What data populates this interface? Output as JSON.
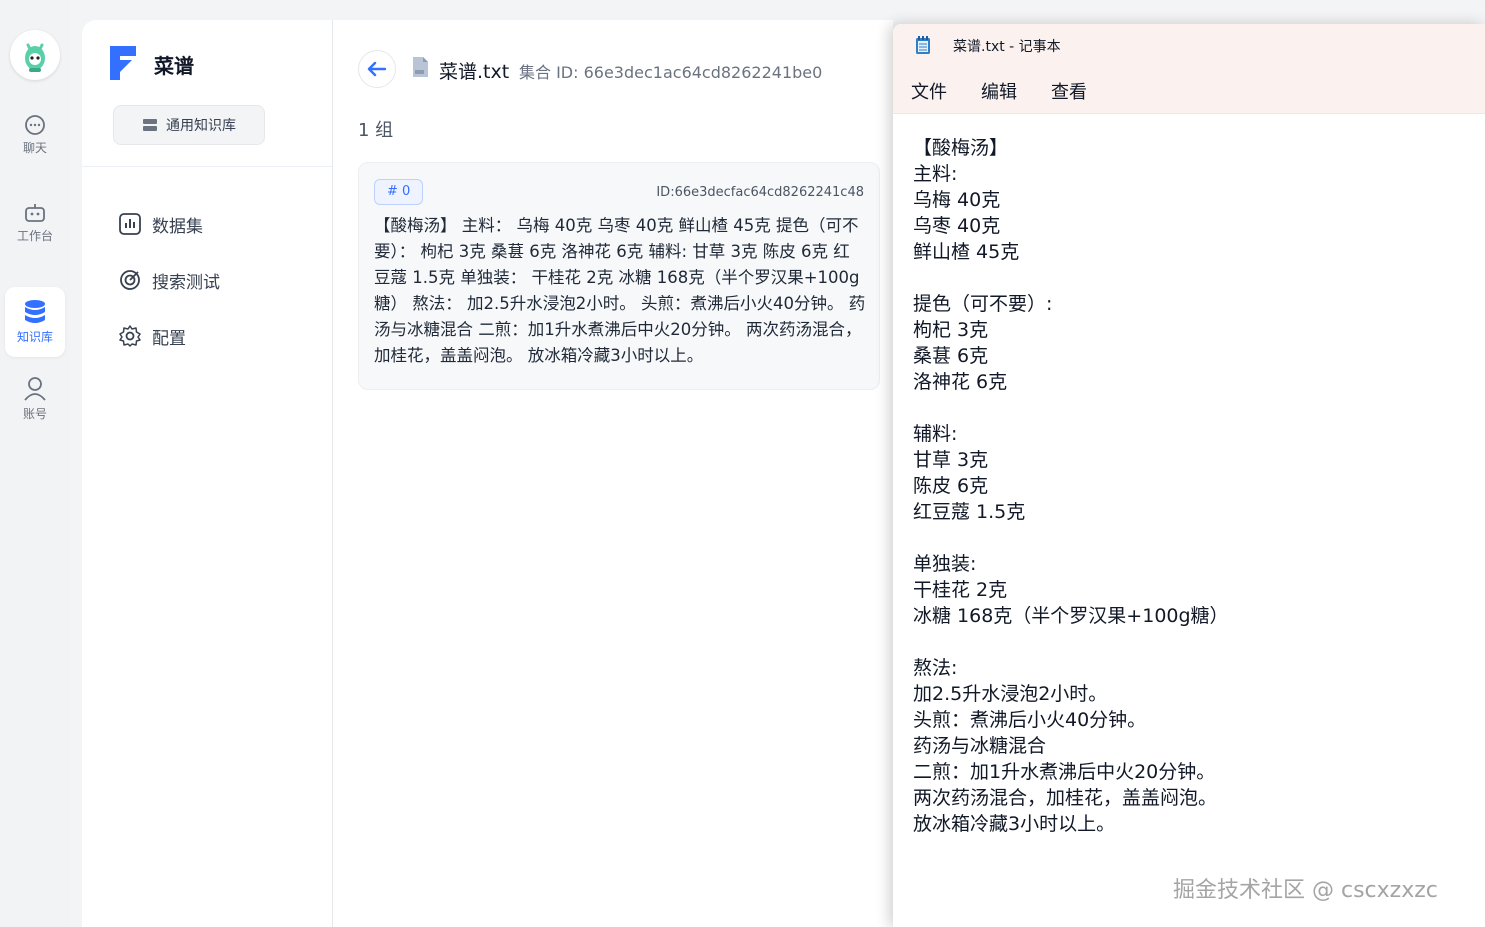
{
  "rail": {
    "items": [
      {
        "label": "聊天",
        "icon": "chat-icon"
      },
      {
        "label": "工作台",
        "icon": "robot-icon"
      },
      {
        "label": "知识库",
        "icon": "database-icon",
        "active": true
      },
      {
        "label": "账号",
        "icon": "user-icon"
      }
    ]
  },
  "sidebar": {
    "title": "菜谱",
    "kb_type": "通用知识库",
    "nav": [
      {
        "label": "数据集",
        "icon": "chart-icon"
      },
      {
        "label": "搜索测试",
        "icon": "target-icon"
      },
      {
        "label": "配置",
        "icon": "gear-icon"
      }
    ]
  },
  "main": {
    "file_name": "菜谱.txt",
    "collection_id": "集合 ID: 66e3dec1ac64cd8262241be0",
    "group_count": "1 组",
    "card": {
      "index": "# 0",
      "id": "ID:66e3decfac64cd8262241c48",
      "text": "【酸梅汤】 主料： 乌梅 40克 乌枣 40克 鲜山楂 45克 提色（可不要）： 枸杞 3克 桑葚 6克 洛神花 6克 辅料: 甘草 3克 陈皮 6克 红豆蔻 1.5克 单独装： 干桂花 2克 冰糖 168克（半个罗汉果+100g糖） 熬法： 加2.5升水浸泡2小时。 头煎：煮沸后小火40分钟。 药汤与冰糖混合 二煎：加1升水煮沸后中火20分钟。 两次药汤混合，加桂花，盖盖闷泡。 放冰箱冷藏3小时以上。"
    }
  },
  "notepad": {
    "title": "菜谱.txt - 记事本",
    "menus": [
      "文件",
      "编辑",
      "查看"
    ],
    "content": "【酸梅汤】\n主料:\n乌梅 40克\n乌枣 40克\n鲜山楂 45克\n\n提色（可不要）:\n枸杞 3克\n桑葚 6克\n洛神花 6克\n\n辅料:\n甘草 3克\n陈皮 6克\n红豆蔻 1.5克\n\n单独装:\n干桂花 2克\n冰糖 168克（半个罗汉果+100g糖）\n\n熬法:\n加2.5升水浸泡2小时。\n头煎：煮沸后小火40分钟。\n药汤与冰糖混合\n二煎：加1升水煮沸后中火20分钟。\n两次药汤混合，加桂花，盖盖闷泡。\n放冰箱冷藏3小时以上。",
    "watermark": "掘金技术社区 @ cscxzxzc"
  },
  "colors": {
    "accent": "#3370ff",
    "notepad_chrome": "#fbf2ef"
  }
}
